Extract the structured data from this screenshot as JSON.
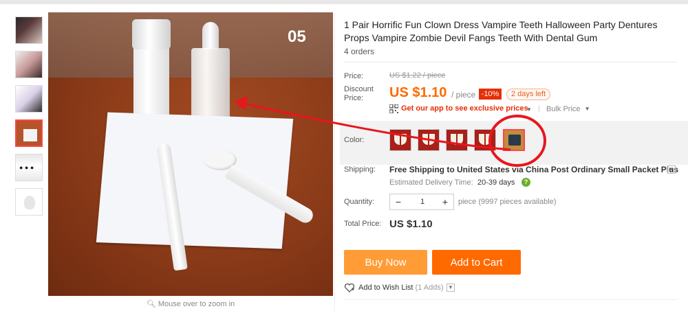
{
  "thumbnails": [
    {
      "name": "thumbnail-1"
    },
    {
      "name": "thumbnail-2"
    },
    {
      "name": "thumbnail-3"
    },
    {
      "name": "thumbnail-4",
      "active": true
    },
    {
      "name": "thumbnail-5"
    },
    {
      "name": "thumbnail-6"
    }
  ],
  "main_image": {
    "overlay_label": "05",
    "zoom_hint": "Mouse over to zoom in",
    "zoom_icon": "magnifier-icon"
  },
  "product": {
    "title": "1 Pair Horrific Fun Clown Dress Vampire Teeth Halloween Party Dentures Props Vampire Zombie Devil Fangs Teeth With Dental Gum",
    "orders": "4 orders"
  },
  "price": {
    "label": "Price:",
    "original": "US $1.22 / piece",
    "discount_label": "Discount Price:",
    "current": "US $1.10",
    "unit": "/ piece",
    "discount_badge": "-10%",
    "time_left": "2 days left",
    "app_promo": "Get our app to see exclusive prices",
    "bulk_price": "Bulk Price",
    "accent_color": "#ff6a00",
    "badge_color": "#e62e04"
  },
  "color": {
    "label": "Color:",
    "options_count": 5,
    "selected_index": 4
  },
  "shipping": {
    "label": "Shipping:",
    "main_text": "Free Shipping to United States via China Post Ordinary Small Packet Plus",
    "estimated_label": "Estimated Delivery Time:",
    "estimated_value": "20-39 days",
    "help_icon": "question-icon"
  },
  "quantity": {
    "label": "Quantity:",
    "value": "1",
    "minus": "−",
    "plus": "+",
    "stock": "piece (9997 pieces available)"
  },
  "total": {
    "label": "Total Price:",
    "value": "US $1.10"
  },
  "actions": {
    "buy_now": "Buy Now",
    "add_to_cart": "Add to Cart",
    "buy_color": "#ff9c36",
    "cart_color": "#ff6a00",
    "wish_label": "Add to Wish List",
    "wish_count": "(1 Adds)"
  },
  "annotation": {
    "color": "#e8161d"
  }
}
